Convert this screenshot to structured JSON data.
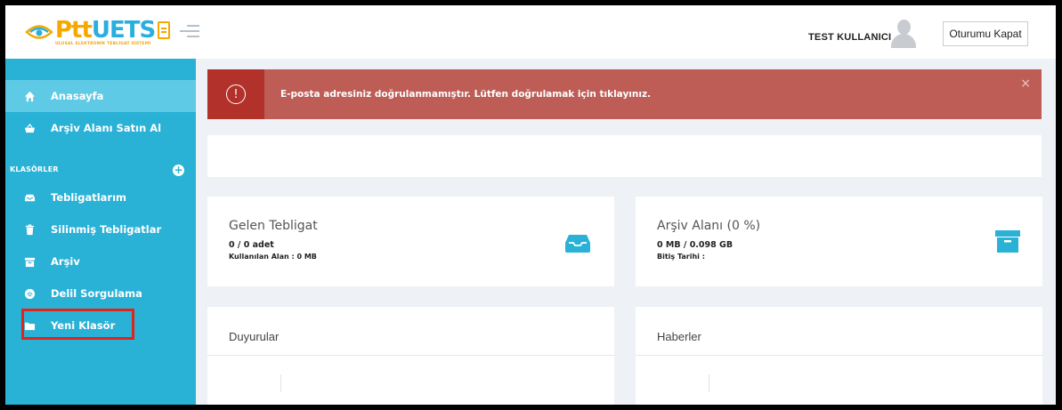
{
  "header": {
    "logo_main_ptt": "Ptt",
    "logo_main_uets": "UETS",
    "logo_sub": "ULUSAL ELEKTRONİK TEBLİGAT SİSTEMİ",
    "user_name": "TEST KULLANICI",
    "logout_label": "Oturumu Kapat"
  },
  "sidebar": {
    "items": [
      {
        "label": "Anasayfa",
        "icon": "home-icon"
      },
      {
        "label": "Arşiv Alanı Satın Al",
        "icon": "basket-icon"
      }
    ],
    "section_label": "KLASÖRLER",
    "folders": [
      {
        "label": "Tebligatlarım",
        "icon": "inbox-icon"
      },
      {
        "label": "Silinmiş Tebligatlar",
        "icon": "trash-icon"
      },
      {
        "label": "Arşiv",
        "icon": "archive-icon"
      },
      {
        "label": "Delil Sorgulama",
        "icon": "fingerprint-icon"
      },
      {
        "label": "Yeni Klasör",
        "icon": "folder-icon"
      }
    ]
  },
  "alert": {
    "text": "E-posta adresiniz doğrulanmamıştır. Lütfen doğrulamak için tıklayınız.",
    "icon": "exclamation-icon",
    "close": "×"
  },
  "cards": {
    "incoming": {
      "title": "Gelen Tebligat",
      "count": "0 / 0 adet",
      "used": "Kullanılan Alan : 0 MB"
    },
    "archive": {
      "title": "Arşiv Alanı (0 %)",
      "size": "0 MB / 0.098 GB",
      "expiry": "Bitiş Tarihi :"
    }
  },
  "panels": {
    "announcements": "Duyurular",
    "news": "Haberler"
  },
  "colors": {
    "sidebar": "#29b1d6",
    "sidebar_active": "#5fcae6",
    "alert": "#bd5d56",
    "alert_icon_bg": "#b2312b",
    "highlight": "#e2231a"
  }
}
